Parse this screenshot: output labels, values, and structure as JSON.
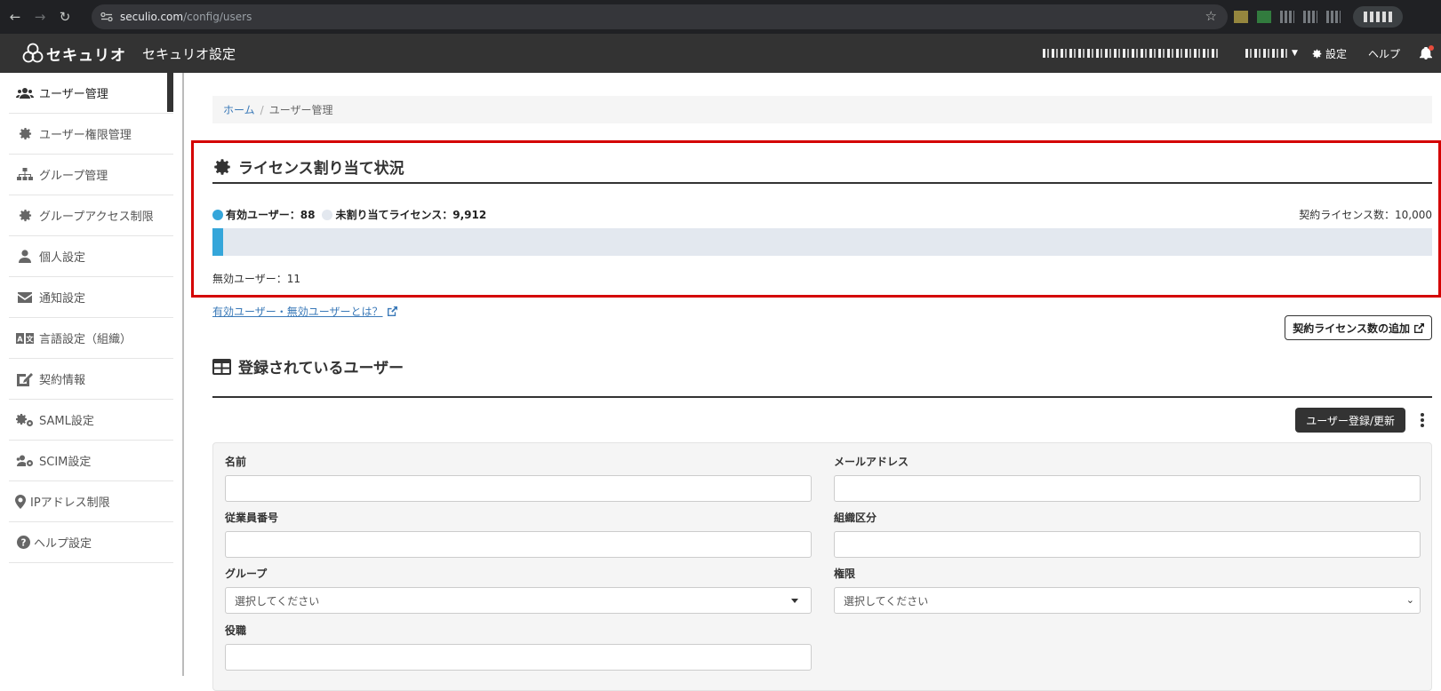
{
  "browser": {
    "url_host": "seculio.com",
    "url_path": "/config/users"
  },
  "app": {
    "logo_text": "セキュリオ",
    "title": "セキュリオ設定",
    "settings_label": "設定",
    "help_label": "ヘルプ"
  },
  "sidebar": {
    "items": [
      {
        "label": "ユーザー管理",
        "icon": "users-icon"
      },
      {
        "label": "ユーザー権限管理",
        "icon": "gear-icon"
      },
      {
        "label": "グループ管理",
        "icon": "sitemap-icon"
      },
      {
        "label": "グループアクセス制限",
        "icon": "gear-icon"
      },
      {
        "label": "個人設定",
        "icon": "user-icon"
      },
      {
        "label": "通知設定",
        "icon": "envelope-icon"
      },
      {
        "label": "言語設定（組織）",
        "icon": "language-icon"
      },
      {
        "label": "契約情報",
        "icon": "contract-icon"
      },
      {
        "label": "SAML設定",
        "icon": "gears-icon"
      },
      {
        "label": "SCIM設定",
        "icon": "users-gear-icon"
      },
      {
        "label": "IPアドレス制限",
        "icon": "map-pin-icon"
      },
      {
        "label": "ヘルプ設定",
        "icon": "question-circle-icon"
      }
    ]
  },
  "breadcrumb": {
    "home": "ホーム",
    "separator": "/",
    "current": "ユーザー管理"
  },
  "license": {
    "title": "ライセンス割り当て状況",
    "active_label": "有効ユーザー：88",
    "unassigned_label": "未割り当てライセンス：9,912",
    "contract_label": "契約ライセンス数：10,000",
    "inactive_label": "無効ユーザー：11",
    "active_fraction": 0.0088,
    "active_color": "#35a6da",
    "unassigned_color": "#e3e8ef"
  },
  "links": {
    "help_link": "有効ユーザー・無効ユーザーとは？",
    "add_license_button": "契約ライセンス数の追加"
  },
  "users": {
    "title": "登録されているユーザー",
    "register_button": "ユーザー登録/更新"
  },
  "filters": {
    "name_label": "名前",
    "email_label": "メールアドレス",
    "employee_no_label": "従業員番号",
    "org_division_label": "組織区分",
    "group_label": "グループ",
    "group_value": "選択してください",
    "permission_label": "権限",
    "permission_value": "選択してください",
    "position_label": "役職"
  }
}
